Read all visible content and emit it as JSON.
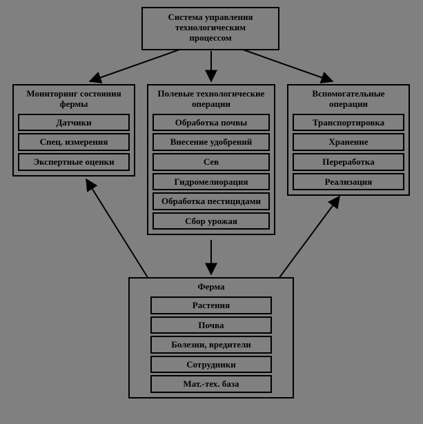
{
  "top": {
    "title_l1": "Система управления",
    "title_l2": "технологическим",
    "title_l3": "процессом"
  },
  "monitoring": {
    "title_l1": "Мониторинг состояния",
    "title_l2": "фермы",
    "items": [
      "Датчики",
      "Спец. измерения",
      "Экспертные оценки"
    ]
  },
  "field_ops": {
    "title_l1": "Полевые технологические",
    "title_l2": "операции",
    "items": [
      "Обработка почвы",
      "Внесение удобрений",
      "Сев",
      "Гидромелиорация",
      "Обработка пестицидами",
      "Сбор урожая"
    ]
  },
  "aux_ops": {
    "title_l1": "Вспомогательные",
    "title_l2": "операции",
    "items": [
      "Транспортировка",
      "Хранение",
      "Переработка",
      "Реализация"
    ]
  },
  "farm": {
    "title": "Ферма",
    "items": [
      "Растения",
      "Почва",
      "Болезни, вредители",
      "Сотрудники",
      "Мат.-тех. база"
    ]
  }
}
